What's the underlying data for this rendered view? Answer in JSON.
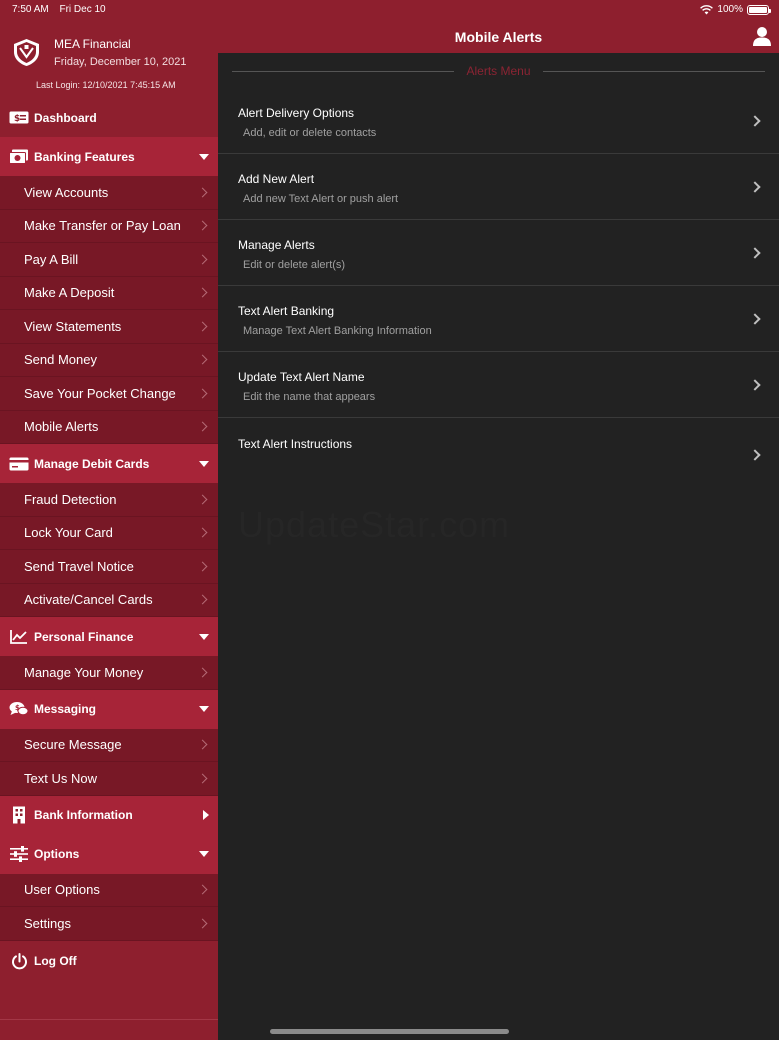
{
  "status_bar": {
    "time": "7:50 AM",
    "date": "Fri Dec 10",
    "battery": "100%",
    "wifi_icon": "wifi-icon",
    "battery_icon": "battery-icon"
  },
  "profile": {
    "bank_name": "MEA Financial",
    "date": "Friday, December 10, 2021",
    "last_login": "Last Login: 12/10/2021 7:45:15 AM",
    "logo_icon": "bank-logo"
  },
  "sidebar": {
    "dashboard": {
      "label": "Dashboard",
      "icon": "dollar-bill-icon"
    },
    "sections": [
      {
        "label": "Banking Features",
        "icon": "money-icon",
        "expanded": true,
        "items": [
          "View Accounts",
          "Make Transfer or Pay Loan",
          "Pay A Bill",
          "Make A Deposit",
          "View Statements",
          "Send Money",
          "Save Your Pocket Change",
          "Mobile Alerts"
        ]
      },
      {
        "label": "Manage Debit Cards",
        "icon": "credit-card-icon",
        "expanded": true,
        "items": [
          "Fraud Detection",
          "Lock Your Card",
          "Send Travel Notice",
          "Activate/Cancel Cards"
        ]
      },
      {
        "label": "Personal Finance",
        "icon": "chart-icon",
        "expanded": true,
        "items": [
          "Manage Your Money"
        ]
      },
      {
        "label": "Messaging",
        "icon": "chat-bubbles-icon",
        "expanded": true,
        "items": [
          "Secure Message",
          "Text Us Now"
        ]
      },
      {
        "label": "Bank Information",
        "icon": "building-icon",
        "expanded": false,
        "items": []
      },
      {
        "label": "Options",
        "icon": "sliders-icon",
        "expanded": true,
        "items": [
          "User Options",
          "Settings"
        ]
      }
    ],
    "logoff": {
      "label": "Log Off",
      "icon": "power-icon"
    }
  },
  "header": {
    "title": "Mobile Alerts",
    "user_icon": "user-icon"
  },
  "alerts_menu": {
    "title": "Alerts Menu",
    "items": [
      {
        "title": "Alert Delivery Options",
        "subtitle": "Add, edit or delete contacts"
      },
      {
        "title": "Add New Alert",
        "subtitle": "Add new Text Alert or push alert"
      },
      {
        "title": "Manage Alerts",
        "subtitle": "Edit or delete alert(s)"
      },
      {
        "title": "Text Alert Banking",
        "subtitle": "Manage Text Alert Banking Information"
      },
      {
        "title": "Update Text Alert Name",
        "subtitle": "Edit the name that appears"
      },
      {
        "title": "Text Alert Instructions",
        "subtitle": ""
      }
    ]
  },
  "watermark": "UpdateStar.com",
  "colors": {
    "sidebar_bg": "#8e1f2e",
    "section_bg": "#a72438",
    "subitem_bg": "#781826",
    "main_bg": "#222222",
    "accent_text": "#8b2433"
  }
}
